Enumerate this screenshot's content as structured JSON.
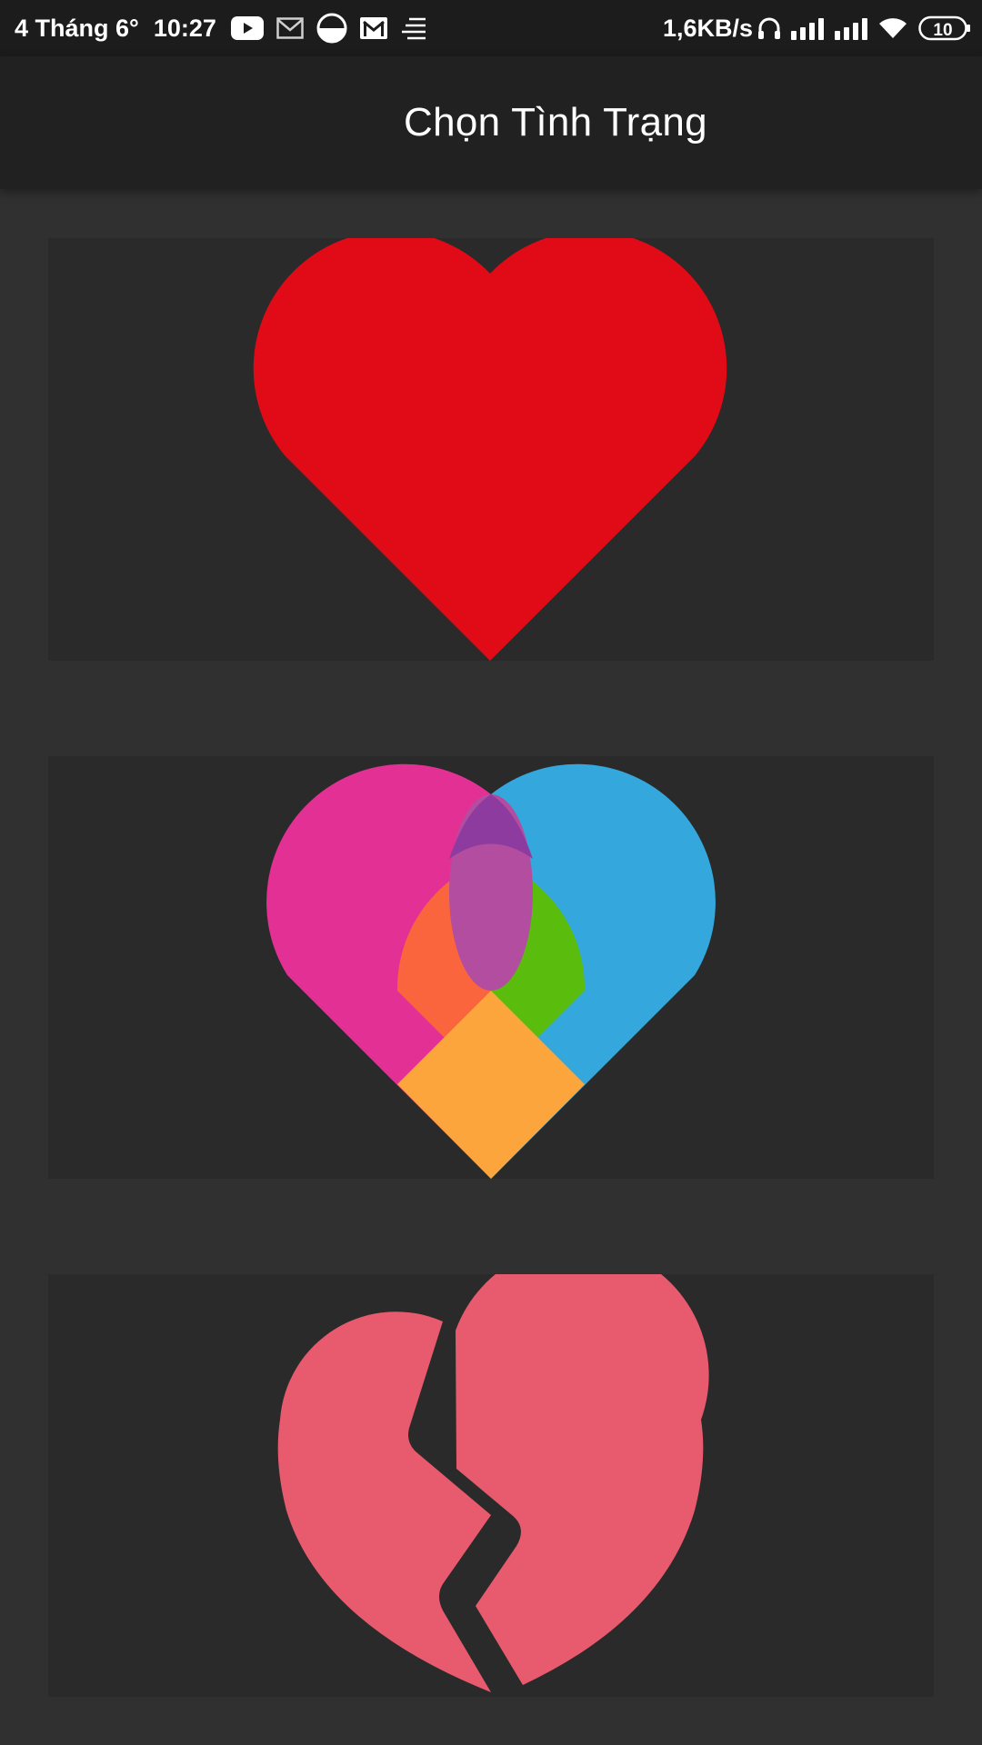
{
  "status_bar": {
    "date": "4 Tháng 6°",
    "time": "10:27",
    "network_speed": "1,6KB/s",
    "battery": "10",
    "left_icons": [
      "youtube-icon",
      "mail-outline-icon",
      "half-circle-icon",
      "gmail-icon",
      "speed-lines-icon"
    ],
    "right_icons": [
      "headphones-icon",
      "signal-icon",
      "signal-icon",
      "wifi-icon",
      "battery-icon"
    ]
  },
  "app_bar": {
    "title": "Chọn Tình Trạng"
  },
  "options": [
    {
      "icon": "red-heart-icon",
      "colors": [
        "#e00b17"
      ]
    },
    {
      "icon": "multicolor-heart-icon",
      "colors": [
        "#e33094",
        "#34a8dc",
        "#fb653e",
        "#5abd0d",
        "#fba53c",
        "#b24d9f",
        "#8d3b9f"
      ]
    },
    {
      "icon": "broken-heart-icon",
      "colors": [
        "#e85a6e"
      ]
    }
  ]
}
